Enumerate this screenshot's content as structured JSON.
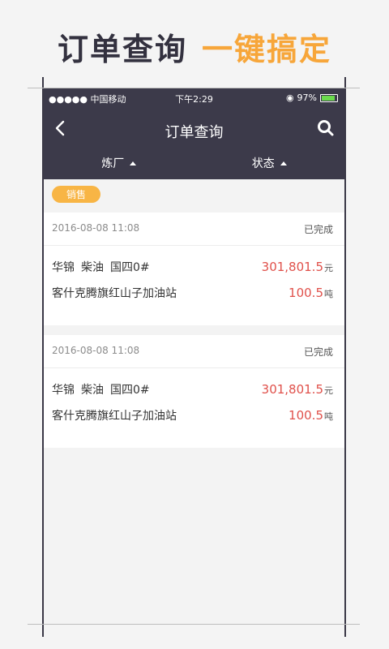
{
  "promo": {
    "title_main": "订单查询",
    "title_accent": "一键搞定"
  },
  "statusbar": {
    "carrier": "●●●●● 中国移动",
    "time": "下午2:29",
    "battery_pct": "97%",
    "battery_level": 0.97
  },
  "navbar": {
    "title": "订单查询"
  },
  "filters": [
    {
      "label": "炼厂"
    },
    {
      "label": "状态"
    }
  ],
  "section_tag": "销售",
  "orders": [
    {
      "datetime": "2016-08-08  11:08",
      "status": "已完成",
      "brand": "华锦",
      "product": "柴油",
      "grade": "国四0#",
      "amount": "301,801.5",
      "amount_unit": "元",
      "station": "客什克腾旗红山子加油站",
      "quantity": "100.5",
      "quantity_unit": "吨"
    },
    {
      "datetime": "2016-08-08  11:08",
      "status": "已完成",
      "brand": "华锦",
      "product": "柴油",
      "grade": "国四0#",
      "amount": "301,801.5",
      "amount_unit": "元",
      "station": "客什克腾旗红山子加油站",
      "quantity": "100.5",
      "quantity_unit": "吨"
    }
  ],
  "colors": {
    "nav_bg": "#3c3a4a",
    "accent": "#f7a63a",
    "tag_bg": "#f8b545",
    "amount": "#e0514b"
  }
}
